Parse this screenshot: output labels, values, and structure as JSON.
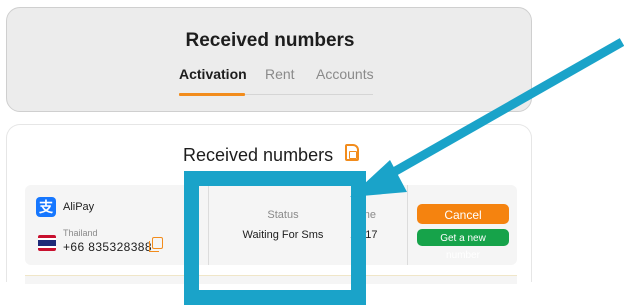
{
  "header": {
    "title": "Received numbers",
    "tabs": [
      {
        "label": "Activation",
        "active": true
      },
      {
        "label": "Rent",
        "active": false
      },
      {
        "label": "Accounts",
        "active": false
      }
    ]
  },
  "main": {
    "title": "Received numbers",
    "title_icon": "sim-card-icon",
    "order": {
      "service_name": "AliPay",
      "service_icon": "alipay-icon",
      "country": "Thailand",
      "phone": "+66 835328388",
      "status_label": "Status",
      "status_value": "Waiting For Sms",
      "time_label": "Time",
      "time_value": "17:17",
      "cancel_label": "Cancel",
      "new_number_label": "Get a new number"
    }
  },
  "annotation": {
    "highlight_color": "#1aa3c9"
  },
  "colors": {
    "accent": "#f28c1c",
    "cancel": "#f5830f",
    "success": "#16a34a"
  }
}
